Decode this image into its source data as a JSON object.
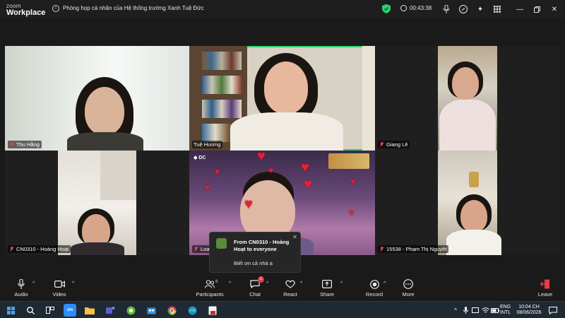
{
  "app": {
    "brand_line1": "zoom",
    "brand_line2": "Workplace",
    "meeting_title": "Phòng họp cá nhân của Hệ thống trường Xanh Tuệ Đức",
    "timer": "00:43:38"
  },
  "participants_tiles": [
    {
      "name": "Thu Hằng",
      "muted": true
    },
    {
      "name": "Tuệ Hương",
      "muted": false,
      "active_speaker": true
    },
    {
      "name": "Giang Lê",
      "muted": true
    },
    {
      "name": "CN0310 - Hoàng Hoạt",
      "muted": true
    },
    {
      "name": "Loan",
      "muted": true
    },
    {
      "name": "15538 - Phạm Thị Nguyệt",
      "muted": true
    }
  ],
  "chat_toast": {
    "from": "From CN0310 - Hoàng Hoạt to everyone",
    "message": "Biết ơn cả nhà ạ"
  },
  "toolbar": {
    "audio": "Audio",
    "video": "Video",
    "participants": "Participants",
    "participants_count": "6",
    "chat": "Chat",
    "chat_badge": "1",
    "react": "React",
    "share": "Share",
    "record": "Record",
    "more": "More",
    "leave": "Leave"
  },
  "taskbar": {
    "lang_line1": "ENG",
    "lang_line2": "INTL",
    "time": "10:04 CH",
    "date": "08/06/2026"
  },
  "colors": {
    "active_speaker": "#2bd36b",
    "muted": "#e0404a",
    "leave": "#e0404a"
  }
}
